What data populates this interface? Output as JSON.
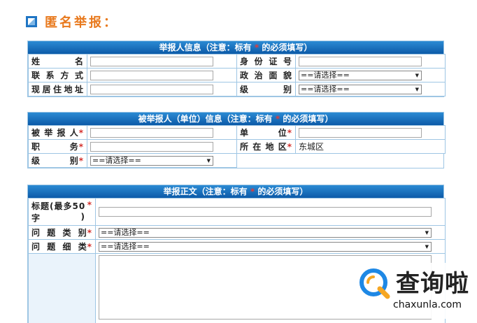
{
  "header": {
    "title": "匿名举报：",
    "icon": "page-icon",
    "accent": "#e8791d"
  },
  "colors": {
    "panel_head_top": "#2b8ad3",
    "panel_head_bottom": "#0c5aa8",
    "border": "#9ec6e4",
    "required": "#d4302c"
  },
  "reporter": {
    "title_pre": "举报人信息（注意：标有",
    "title_dot": "*",
    "title_post": "的必须填写）",
    "labels": {
      "name": "姓　　名",
      "id_number": "身份证号",
      "contact": "联系方式",
      "political_status": "政治面貌",
      "address": "现居住地址",
      "level": "级　　别"
    },
    "political_status_value": "==请选择==",
    "level_value": "==请选择=="
  },
  "reported": {
    "title_pre": "被举报人（单位）信息（注意：标有",
    "title_dot": "*",
    "title_post": "的必须填写）",
    "labels": {
      "name": "被举报人",
      "unit": "单　　位",
      "position": "职　　务",
      "region": "所在地区",
      "level": "级　　别"
    },
    "region_value": "东城区",
    "level_value": "==请选择=="
  },
  "body": {
    "title_pre": "举报正文（注意：标有",
    "title_dot": "*",
    "title_post": "的必须填写）",
    "labels": {
      "subject_line1": "标题(最多50",
      "subject_line2_a": "字",
      "subject_line2_b": ")",
      "category": "问题类别",
      "subcategory": "问题细类"
    },
    "category_value": "==请选择==",
    "subcategory_value": "==请选择=="
  },
  "required_mark": "*",
  "watermark": {
    "brand": "查询啦",
    "url": "chaxunla.com",
    "icon": "chaxunla-logo-icon"
  }
}
